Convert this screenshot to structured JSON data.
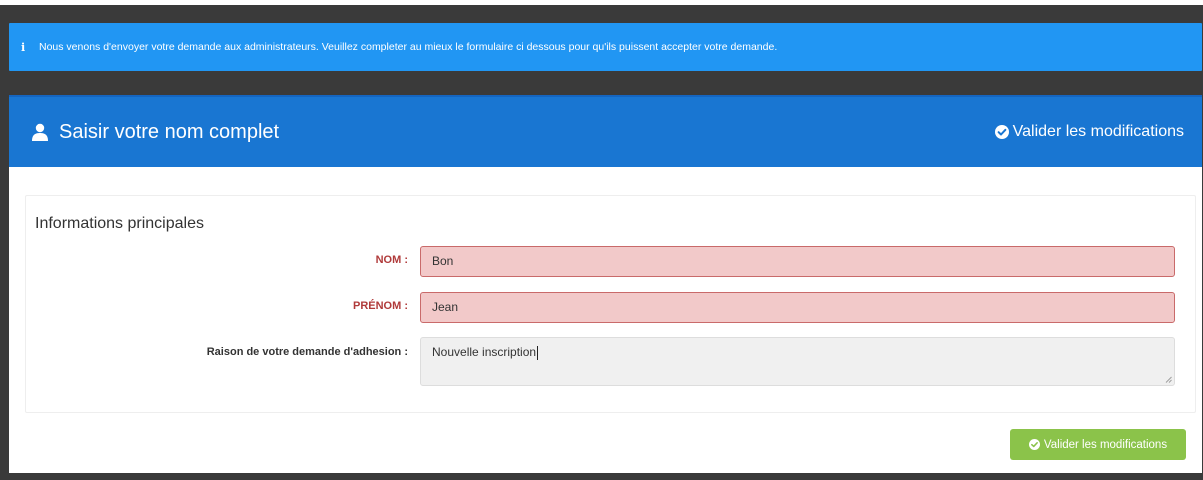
{
  "alert": {
    "icon": "info-icon",
    "message": "Nous venons d'envoyer votre demande aux administrateurs. Veuillez completer au mieux le formulaire ci dessous pour qu'ils puissent accepter votre demande."
  },
  "header": {
    "icon": "user-icon",
    "title": "Saisir votre nom complet",
    "action_label": "Valider les modifications"
  },
  "form": {
    "section_title": "Informations principales",
    "fields": [
      {
        "label": "NOM :",
        "value": "Bon",
        "state": "error"
      },
      {
        "label": "PRÉNOM :",
        "value": "Jean",
        "state": "error"
      },
      {
        "label": "Raison de votre demande d'adhesion :",
        "value": "Nouvelle inscription",
        "state": "normal"
      }
    ]
  },
  "footer": {
    "submit_label": "Valider les modifications"
  },
  "colors": {
    "alert_bg": "#2196f3",
    "header_bg": "#1976d2",
    "error_bg": "#f2c9c9",
    "error_label": "#b03a3a",
    "submit_bg": "#8bc34a",
    "page_bg": "#3a3a3a"
  }
}
